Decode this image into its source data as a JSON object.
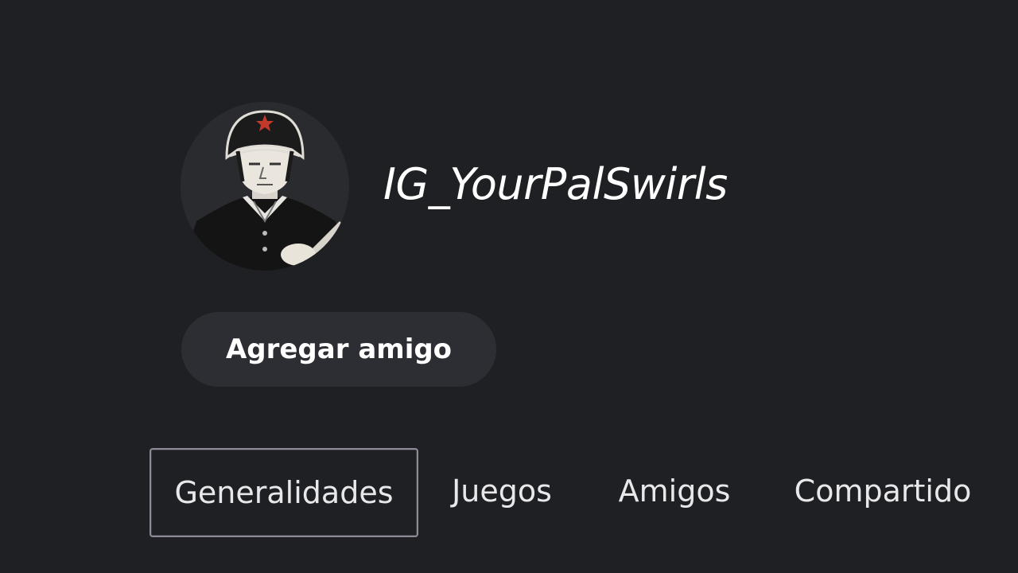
{
  "profile": {
    "username": "IG_YourPalSwirls",
    "avatar_icon": "soldier-avatar-icon",
    "add_friend_label": "Agregar amigo"
  },
  "tabs": [
    {
      "label": "Generalidades",
      "selected": true
    },
    {
      "label": "Juegos",
      "selected": false
    },
    {
      "label": "Amigos",
      "selected": false
    },
    {
      "label": "Compartido",
      "selected": false
    }
  ],
  "colors": {
    "background": "#1f2024",
    "button": "#2d2e33",
    "accent_star": "#c0392b"
  }
}
